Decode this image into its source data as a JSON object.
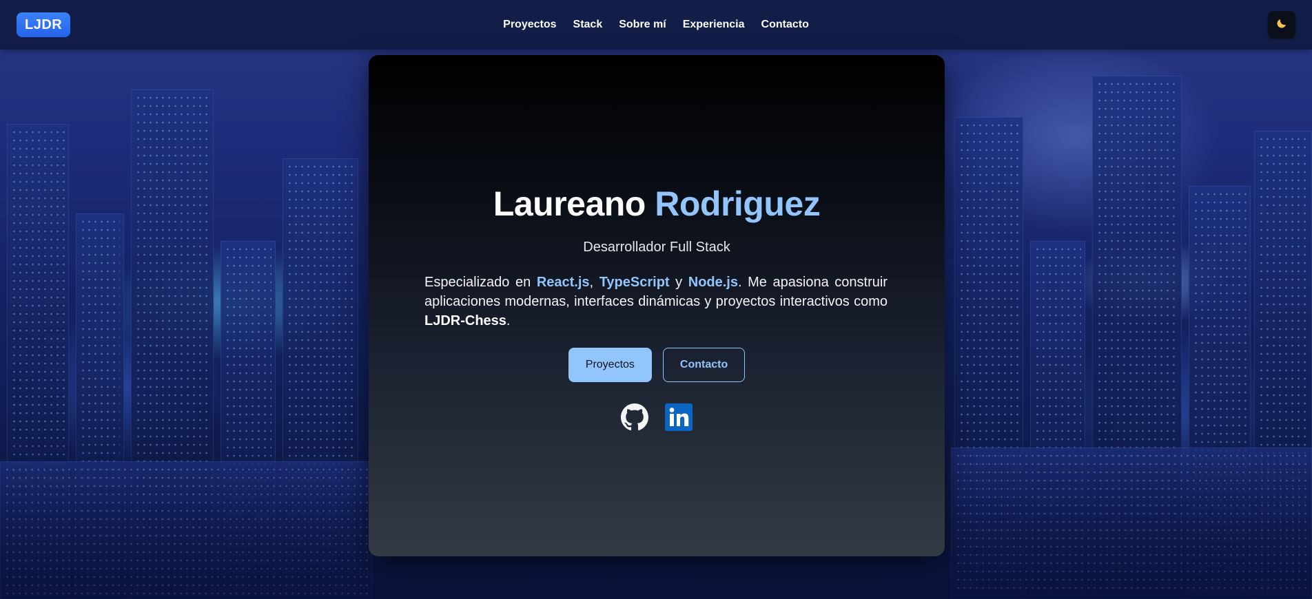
{
  "nav": {
    "logo": "LJDR",
    "links": [
      {
        "label": "Proyectos"
      },
      {
        "label": "Stack"
      },
      {
        "label": "Sobre mí"
      },
      {
        "label": "Experiencia"
      },
      {
        "label": "Contacto"
      }
    ],
    "theme_toggle_icon": "moon-icon"
  },
  "hero": {
    "first_name": "Laureano",
    "last_name": "Rodriguez",
    "role": "Desarrollador Full Stack",
    "desc": {
      "part1": "Especializado en ",
      "tech1": "React.js",
      "sep1": ", ",
      "tech2": "TypeScript",
      "sep2": " y ",
      "tech3": "Node.js",
      "part2": ". Me apasiona construir aplicaciones modernas, interfaces dinámicas y proyectos interactivos como ",
      "project": "LJDR-Chess",
      "part3": "."
    },
    "buttons": {
      "primary": "Proyectos",
      "secondary": "Contacto"
    },
    "socials": [
      {
        "icon": "github-icon"
      },
      {
        "icon": "linkedin-icon"
      }
    ]
  },
  "colors": {
    "accent": "#93c5fd",
    "logo_bg": "#2563eb",
    "nav_bg": "#0f183a",
    "card_top": "#000000",
    "card_bottom": "#333a45",
    "linkedin": "#0a66c2"
  }
}
